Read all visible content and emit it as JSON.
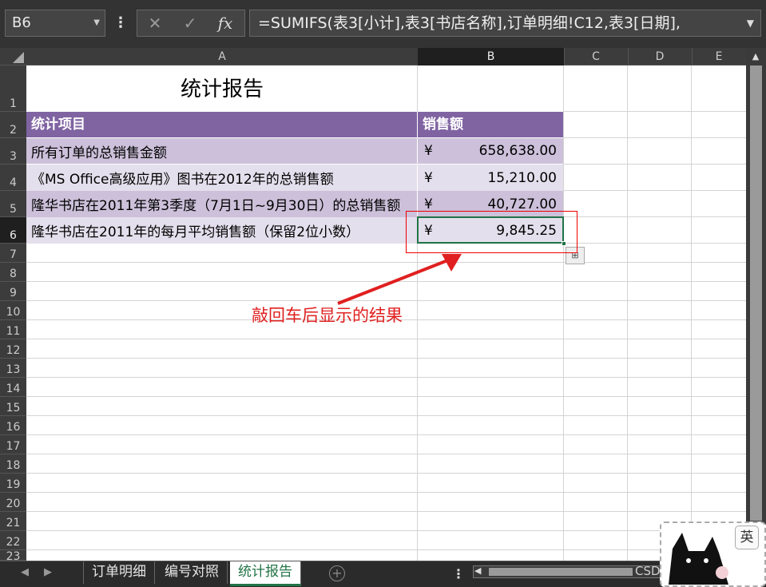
{
  "formula_bar": {
    "name_box": "B6",
    "dots": "⋮",
    "cancel_icon": "✕",
    "enter_icon": "✓",
    "fx_label": "fx",
    "formula": "=SUMIFS(表3[小计],表3[书店名称],订单明细!C12,表3[日期],"
  },
  "columns": [
    "A",
    "B",
    "C",
    "D",
    "E"
  ],
  "selected_column": "B",
  "rows": [
    "1",
    "2",
    "3",
    "4",
    "5",
    "6",
    "7",
    "8",
    "9",
    "10",
    "11",
    "12",
    "13",
    "14",
    "15",
    "16",
    "17",
    "18",
    "19",
    "20",
    "21",
    "22",
    "23"
  ],
  "selected_row": "6",
  "sheet": {
    "title": "统计报告",
    "header": {
      "item": "统计项目",
      "amount": "销售额"
    },
    "currency_symbol": "¥",
    "items": [
      {
        "label": "所有订单的总销售金额",
        "value": "658,638.00"
      },
      {
        "label": "《MS Office高级应用》图书在2012年的总销售额",
        "value": "15,210.00"
      },
      {
        "label": "隆华书店在2011年第3季度（7月1日~9月30日）的总销售额",
        "value": "40,727.00"
      },
      {
        "label": "隆华书店在2011年的每月平均销售额（保留2位小数）",
        "value": "9,845.25"
      }
    ]
  },
  "annotation": "敲回车后显示的结果",
  "colors": {
    "header_fill": "#8064a2",
    "band_dark": "#ccc0da",
    "band_light": "#e4dfec",
    "selection": "#217346",
    "annotation": "#e02020"
  },
  "tabs": {
    "items": [
      "订单明细",
      "编号对照",
      "统计报告"
    ],
    "active": "统计报告",
    "add": "+"
  },
  "ime": {
    "lang": "英"
  },
  "watermark": "CSDN @Oil Correct"
}
